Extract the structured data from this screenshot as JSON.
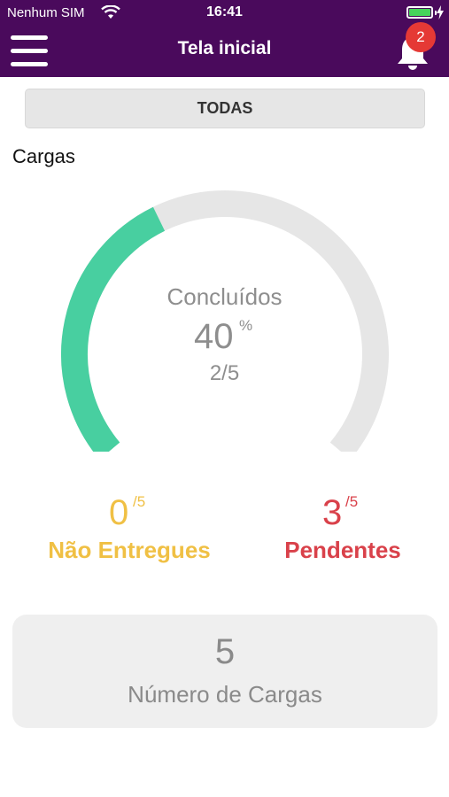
{
  "status_bar": {
    "carrier": "Nenhum SIM",
    "time": "16:41"
  },
  "header": {
    "title": "Tela inicial",
    "notification_count": "2"
  },
  "filter": {
    "label": "TODAS"
  },
  "section": {
    "title": "Cargas"
  },
  "gauge": {
    "label": "Concluídos",
    "percent": "40",
    "percent_sign": "%",
    "fraction": "2/5",
    "progress": 0.4,
    "colors": {
      "progress": "#48cfa0",
      "track": "#e6e6e6"
    }
  },
  "stats": {
    "not_delivered": {
      "value": "0",
      "denominator": "/5",
      "label": "Não Entregues",
      "color": "#f0c044"
    },
    "pending": {
      "value": "3",
      "denominator": "/5",
      "label": "Pendentes",
      "color": "#d9414a"
    }
  },
  "summary": {
    "value": "5",
    "label": "Número de Cargas"
  },
  "icons": {
    "menu": "hamburger-icon",
    "notifications": "bell-icon",
    "wifi": "wifi-icon",
    "battery": "battery-icon"
  },
  "colors": {
    "header": "#4a0a5c",
    "badge": "#e53935"
  }
}
